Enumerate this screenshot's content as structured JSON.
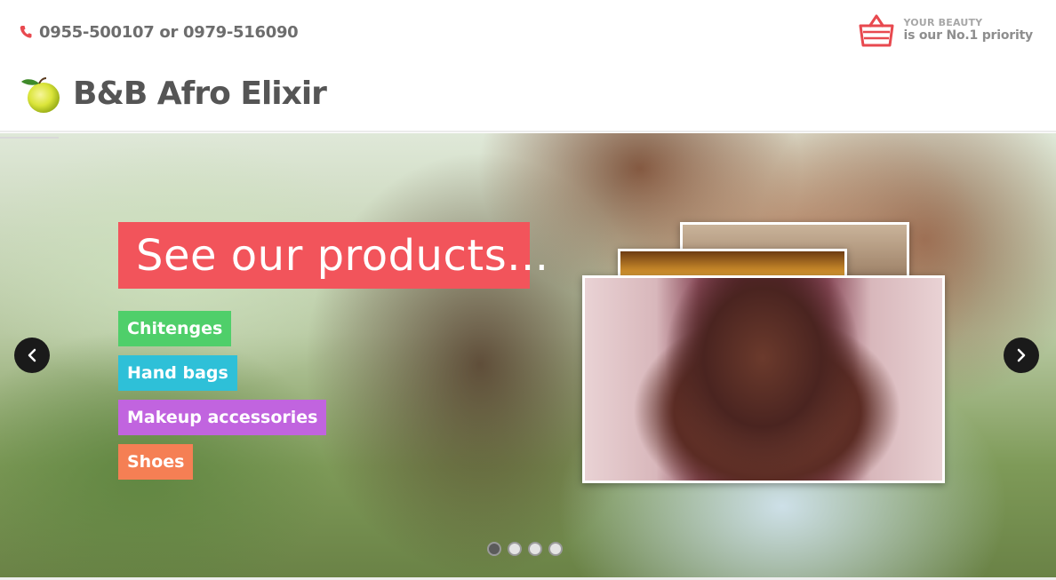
{
  "header": {
    "phone": "0955-500107 or 0979-516090",
    "brand_name": "B&B Afro Elixir",
    "tagline_small": "YOUR BEAUTY",
    "tagline_big": "is our No.1 priority"
  },
  "slider": {
    "headline": "See our products...",
    "categories": [
      {
        "label": "Chitenges",
        "color": "#4fcf6a"
      },
      {
        "label": "Hand bags",
        "color": "#2ec0d8"
      },
      {
        "label": "Makeup accessories",
        "color": "#c164df"
      },
      {
        "label": "Shoes",
        "color": "#f57f54"
      }
    ],
    "active_slide": 1,
    "slide_count": 4
  },
  "colors": {
    "accent": "#f2545b",
    "brand_text": "#555555"
  },
  "icons": {
    "phone": "phone-icon",
    "basket": "basket-icon",
    "logo": "lemon-icon",
    "prev": "chevron-left-icon",
    "next": "chevron-right-icon"
  }
}
